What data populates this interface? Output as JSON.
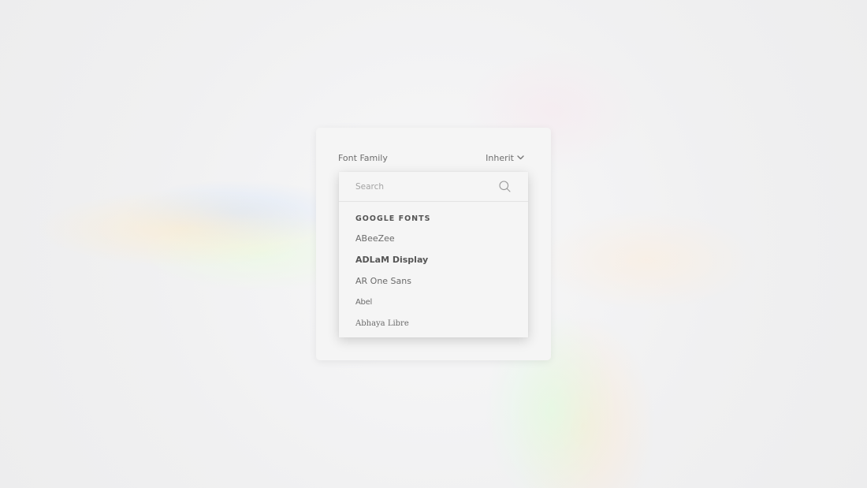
{
  "panel": {
    "label": "Font Family",
    "select_value": "Inherit"
  },
  "dropdown": {
    "search_placeholder": "Search",
    "group_title": "GOOGLE FONTS",
    "items": [
      {
        "label": "ABeeZee",
        "style": "normal"
      },
      {
        "label": "ADLaM Display",
        "style": "bold"
      },
      {
        "label": "AR One Sans",
        "style": "normal"
      },
      {
        "label": "Abel",
        "style": "condensed"
      },
      {
        "label": "Abhaya Libre",
        "style": "serif"
      }
    ]
  },
  "icons": {
    "select": "chevron-down-icon",
    "search": "search-icon"
  },
  "colors": {
    "panel_bg": "#f5f5f5",
    "text": "#6e6e6e",
    "placeholder": "#a3a3a3"
  }
}
